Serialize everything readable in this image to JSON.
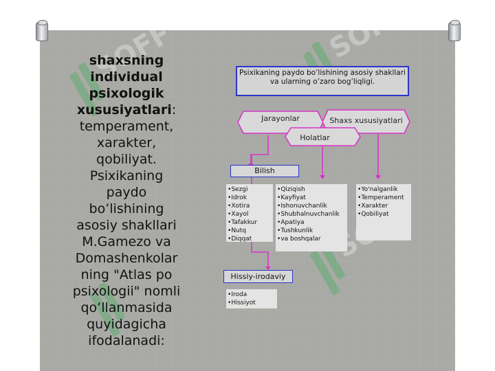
{
  "left_text": {
    "bold": "shaxsning individual psixologik xususiyatlari",
    "rest": ": temperament, xarakter, qobiliyat. Psixikaning paydo bo’lishining asosiy shakllari M.Gamezo va Domashenkolar ning \"Atlas po psixologii\" nomli qo’llanmasida quyidagicha ifodalanadi:"
  },
  "diagram": {
    "top": "Psixikaning paydo bo’lishining asosiy  shakllari va ularning o’zaro bog’liqligi.",
    "jarayonlar": "Jarayonlar",
    "shaxs": "Shaxs xususiyatlari",
    "holatlar": "Holatlar",
    "bilish": "Bilish",
    "hissiy": "Hissiy-irodaviy",
    "bilish_list": [
      "Sezgi",
      "Idrok",
      "Xotira",
      "Xayol",
      "Tafakkur",
      "Nutq",
      "Diqqat"
    ],
    "holat_list": [
      "Qiziqish",
      "Kayfiyat",
      "Ishonuvchanlik",
      "Shubhalnuvchanlik",
      "Apatiya",
      "Tushkunlik",
      "va boshqalar"
    ],
    "shaxs_list": [
      "Yo'nalganlik",
      "Temperament",
      "Xarakter",
      "Qobiliyat"
    ],
    "hissiy_list": [
      "Iroda",
      "Hissiyot"
    ]
  },
  "watermark": "SOFF",
  "colors": {
    "arrow": "#d832c8",
    "box_border": "#2b34c8",
    "slide_bg": "#a9aaa6",
    "watermark": "#36a84c"
  }
}
